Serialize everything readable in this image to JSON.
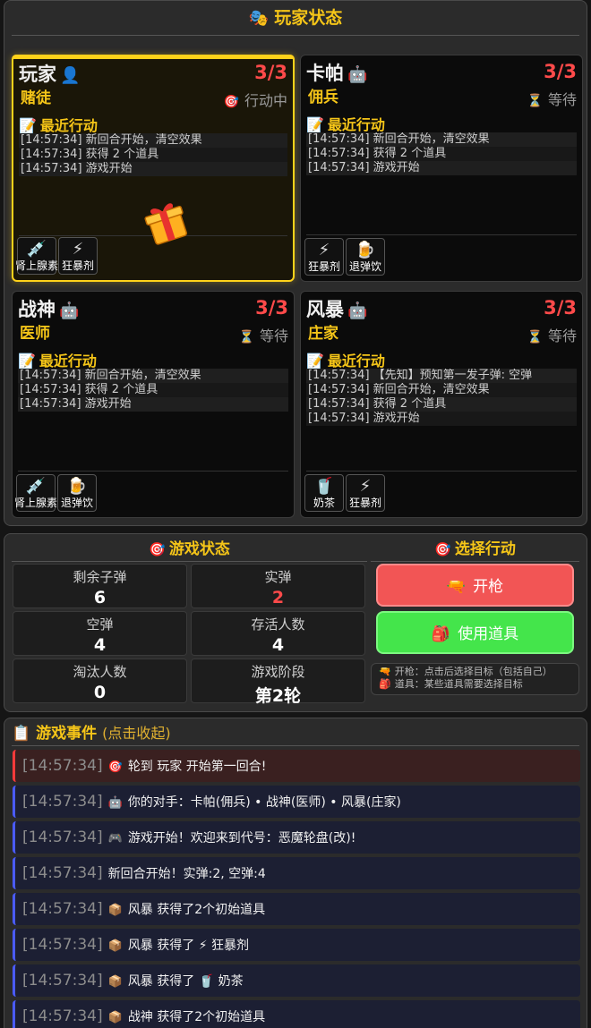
{
  "header": {
    "title": "玩家状态",
    "icon": "masks-icon"
  },
  "players": [
    {
      "name": "玩家",
      "avatar": "👤",
      "hp": "3/3",
      "role": "赌徒",
      "state_icon": "🎯",
      "state": "行动中",
      "recent_title": "最近行动",
      "log": [
        "[14:57:34] 新回合开始，清空效果",
        "[14:57:34] 获得 2 个道具",
        "[14:57:34] 游戏开始"
      ],
      "items": [
        {
          "icon": "💉",
          "name": "肾上腺素"
        },
        {
          "icon": "⚡",
          "name": "狂暴剂"
        }
      ]
    },
    {
      "name": "卡帕",
      "avatar": "🤖",
      "hp": "3/3",
      "role": "佣兵",
      "state_icon": "⏳",
      "state": "等待",
      "recent_title": "最近行动",
      "log": [
        "[14:57:34] 新回合开始，清空效果",
        "[14:57:34] 获得 2 个道具",
        "[14:57:34] 游戏开始"
      ],
      "items": [
        {
          "icon": "⚡",
          "name": "狂暴剂"
        },
        {
          "icon": "🍺",
          "name": "退弹饮"
        }
      ]
    },
    {
      "name": "战神",
      "avatar": "🤖",
      "hp": "3/3",
      "role": "医师",
      "state_icon": "⏳",
      "state": "等待",
      "recent_title": "最近行动",
      "log": [
        "[14:57:34] 新回合开始，清空效果",
        "[14:57:34] 获得 2 个道具",
        "[14:57:34] 游戏开始"
      ],
      "items": [
        {
          "icon": "💉",
          "name": "肾上腺素"
        },
        {
          "icon": "🍺",
          "name": "退弹饮"
        }
      ]
    },
    {
      "name": "风暴",
      "avatar": "🤖",
      "hp": "3/3",
      "role": "庄家",
      "state_icon": "⏳",
      "state": "等待",
      "recent_title": "最近行动",
      "log": [
        "[14:57:34] 【先知】预知第一发子弹: 空弹",
        "[14:57:34] 新回合开始，清空效果",
        "[14:57:34] 获得 2 个道具",
        "[14:57:34] 游戏开始"
      ],
      "items": [
        {
          "icon": "🥤",
          "name": "奶茶"
        },
        {
          "icon": "⚡",
          "name": "狂暴剂"
        }
      ]
    }
  ],
  "game_status": {
    "title": "游戏状态",
    "stats": [
      {
        "label": "剩余子弹",
        "value": "6"
      },
      {
        "label": "实弹",
        "value": "2"
      },
      {
        "label": "空弹",
        "value": "4"
      },
      {
        "label": "存活人数",
        "value": "4"
      },
      {
        "label": "淘汰人数",
        "value": "0"
      },
      {
        "label": "游戏阶段",
        "value": "第2轮"
      }
    ]
  },
  "actions": {
    "title": "选择行动",
    "shoot_label": "开枪",
    "item_label": "使用道具",
    "hint_shoot": "开枪：点击后选择目标（包括自己）",
    "hint_item": "道具：某些道具需要选择目标"
  },
  "events": {
    "title": "游戏事件",
    "subtitle": "(点击收起)",
    "list": [
      {
        "time": "[14:57:34]",
        "icon": "🎯",
        "text": "轮到 玩家 开始第一回合!"
      },
      {
        "time": "[14:57:34]",
        "icon": "🤖",
        "text": "你的对手：卡帕(佣兵) • 战神(医师) • 风暴(庄家)"
      },
      {
        "time": "[14:57:34]",
        "icon": "🎮",
        "text": "游戏开始！欢迎来到代号：恶魔轮盘(改)!"
      },
      {
        "time": "[14:57:34]",
        "icon": "",
        "text": "新回合开始！实弹:2, 空弹:4"
      },
      {
        "time": "[14:57:34]",
        "icon": "📦",
        "text": "风暴 获得了2个初始道具"
      },
      {
        "time": "[14:57:34]",
        "icon": "📦",
        "text": "风暴 获得了 ⚡ 狂暴剂"
      },
      {
        "time": "[14:57:34]",
        "icon": "📦",
        "text": "风暴 获得了 🥤 奶茶"
      },
      {
        "time": "[14:57:34]",
        "icon": "📦",
        "text": "战神 获得了2个初始道具"
      }
    ]
  },
  "colors": {
    "accent": "#f5c518",
    "hp": "#ff4a4a",
    "shoot": "#f25555",
    "use_item": "#44e54b"
  }
}
